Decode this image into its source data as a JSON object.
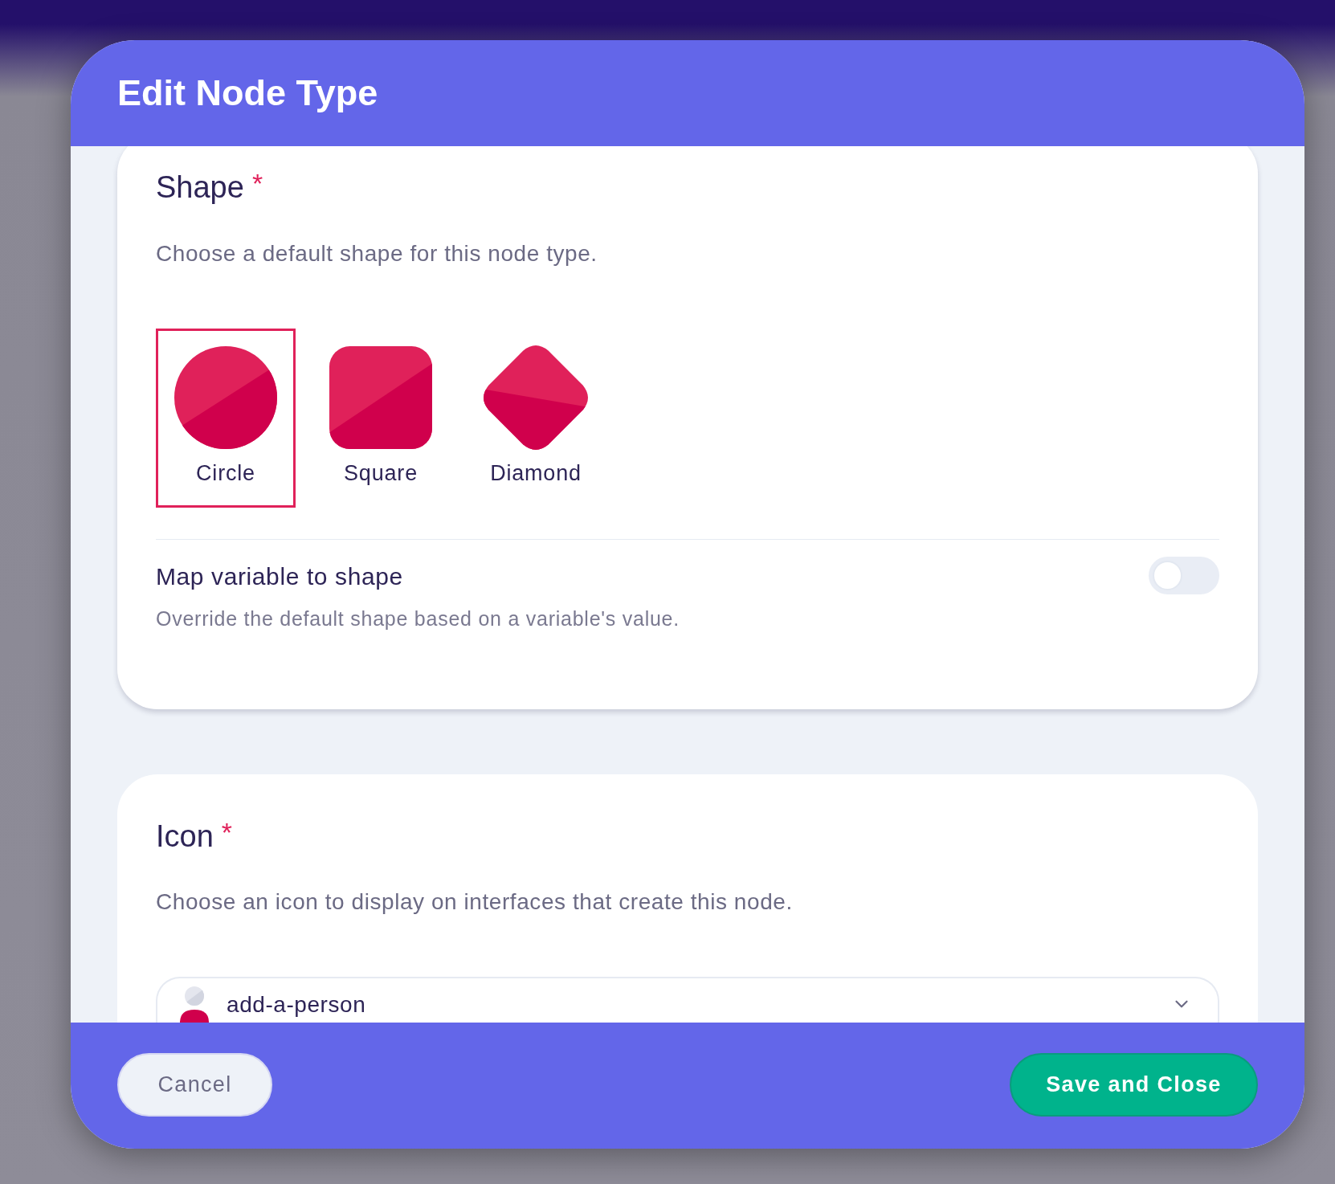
{
  "dialog": {
    "title": "Edit Node Type"
  },
  "shape_section": {
    "title": "Shape",
    "required_mark": "*",
    "description": "Choose a default shape for this node type.",
    "options": [
      {
        "kind": "circle",
        "label": "Circle",
        "selected": true
      },
      {
        "kind": "square",
        "label": "Square",
        "selected": false
      },
      {
        "kind": "diamond",
        "label": "Diamond",
        "selected": false
      }
    ],
    "map_variable": {
      "title": "Map variable to shape",
      "description": "Override the default shape based on a variable's value.",
      "on": false
    }
  },
  "icon_section": {
    "title": "Icon",
    "required_mark": "*",
    "description": "Choose an icon to display on interfaces that create this node.",
    "select": {
      "value": "add-a-person"
    }
  },
  "footer": {
    "cancel": "Cancel",
    "save": "Save and Close"
  }
}
